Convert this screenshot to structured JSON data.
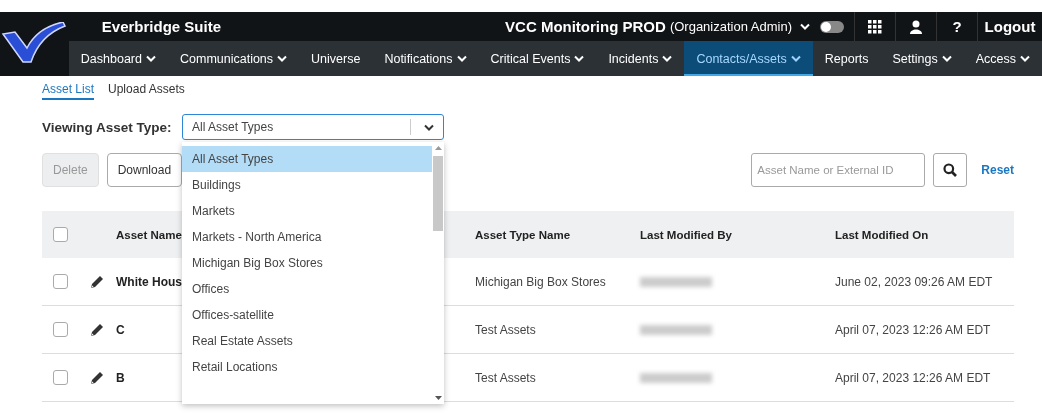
{
  "app": {
    "title": "Everbridge Suite",
    "organization": "VCC Monitoring PROD",
    "role": "(Organization Admin)",
    "toggle_on": false,
    "help": "?",
    "logout": "Logout"
  },
  "nav": [
    {
      "label": "Dashboard",
      "has_menu": true,
      "selected": false
    },
    {
      "label": "Communications",
      "has_menu": true,
      "selected": false
    },
    {
      "label": "Universe",
      "has_menu": false,
      "selected": false
    },
    {
      "label": "Notifications",
      "has_menu": true,
      "selected": false
    },
    {
      "label": "Critical Events",
      "has_menu": true,
      "selected": false
    },
    {
      "label": "Incidents",
      "has_menu": true,
      "selected": false
    },
    {
      "label": "Contacts/Assets",
      "has_menu": true,
      "selected": true
    },
    {
      "label": "Reports",
      "has_menu": false,
      "selected": false
    },
    {
      "label": "Settings",
      "has_menu": true,
      "selected": false
    },
    {
      "label": "Access",
      "has_menu": true,
      "selected": false
    }
  ],
  "tabs": [
    {
      "label": "Asset List",
      "selected": true
    },
    {
      "label": "Upload Assets",
      "selected": false
    }
  ],
  "filter": {
    "label": "Viewing Asset Type:",
    "value": "All Asset Types",
    "expanded": true,
    "options": [
      {
        "label": "All Asset Types",
        "selected": true
      },
      {
        "label": "Buildings",
        "selected": false
      },
      {
        "label": "Markets",
        "selected": false
      },
      {
        "label": "Markets - North America",
        "selected": false
      },
      {
        "label": "Michigan Big Box Stores",
        "selected": false
      },
      {
        "label": "Offices",
        "selected": false
      },
      {
        "label": "Offices-satellite",
        "selected": false
      },
      {
        "label": "Real Estate Assets",
        "selected": false
      },
      {
        "label": "Retail Locations",
        "selected": false
      }
    ]
  },
  "toolbar": {
    "buttons": [
      {
        "label": "Delete",
        "disabled": true
      },
      {
        "label": "Download",
        "disabled": false
      }
    ],
    "search": {
      "placeholder": "Asset Name or External ID"
    },
    "reset": "Reset"
  },
  "table": {
    "all_checked": false,
    "columns": [
      "Asset Name",
      "Asset Type Name",
      "Last Modified By",
      "Last Modified On"
    ],
    "rows": [
      {
        "checked": false,
        "name": "White Hous",
        "type": "Michigan Big Box Stores",
        "modified_on": "June 02, 2023 09:26 AM EDT"
      },
      {
        "checked": false,
        "name": "C",
        "type": "Test Assets",
        "modified_on": "April 07, 2023 12:26 AM EDT"
      },
      {
        "checked": false,
        "name": "B",
        "type": "Test Assets",
        "modified_on": "April 07, 2023 12:26 AM EDT"
      }
    ]
  }
}
